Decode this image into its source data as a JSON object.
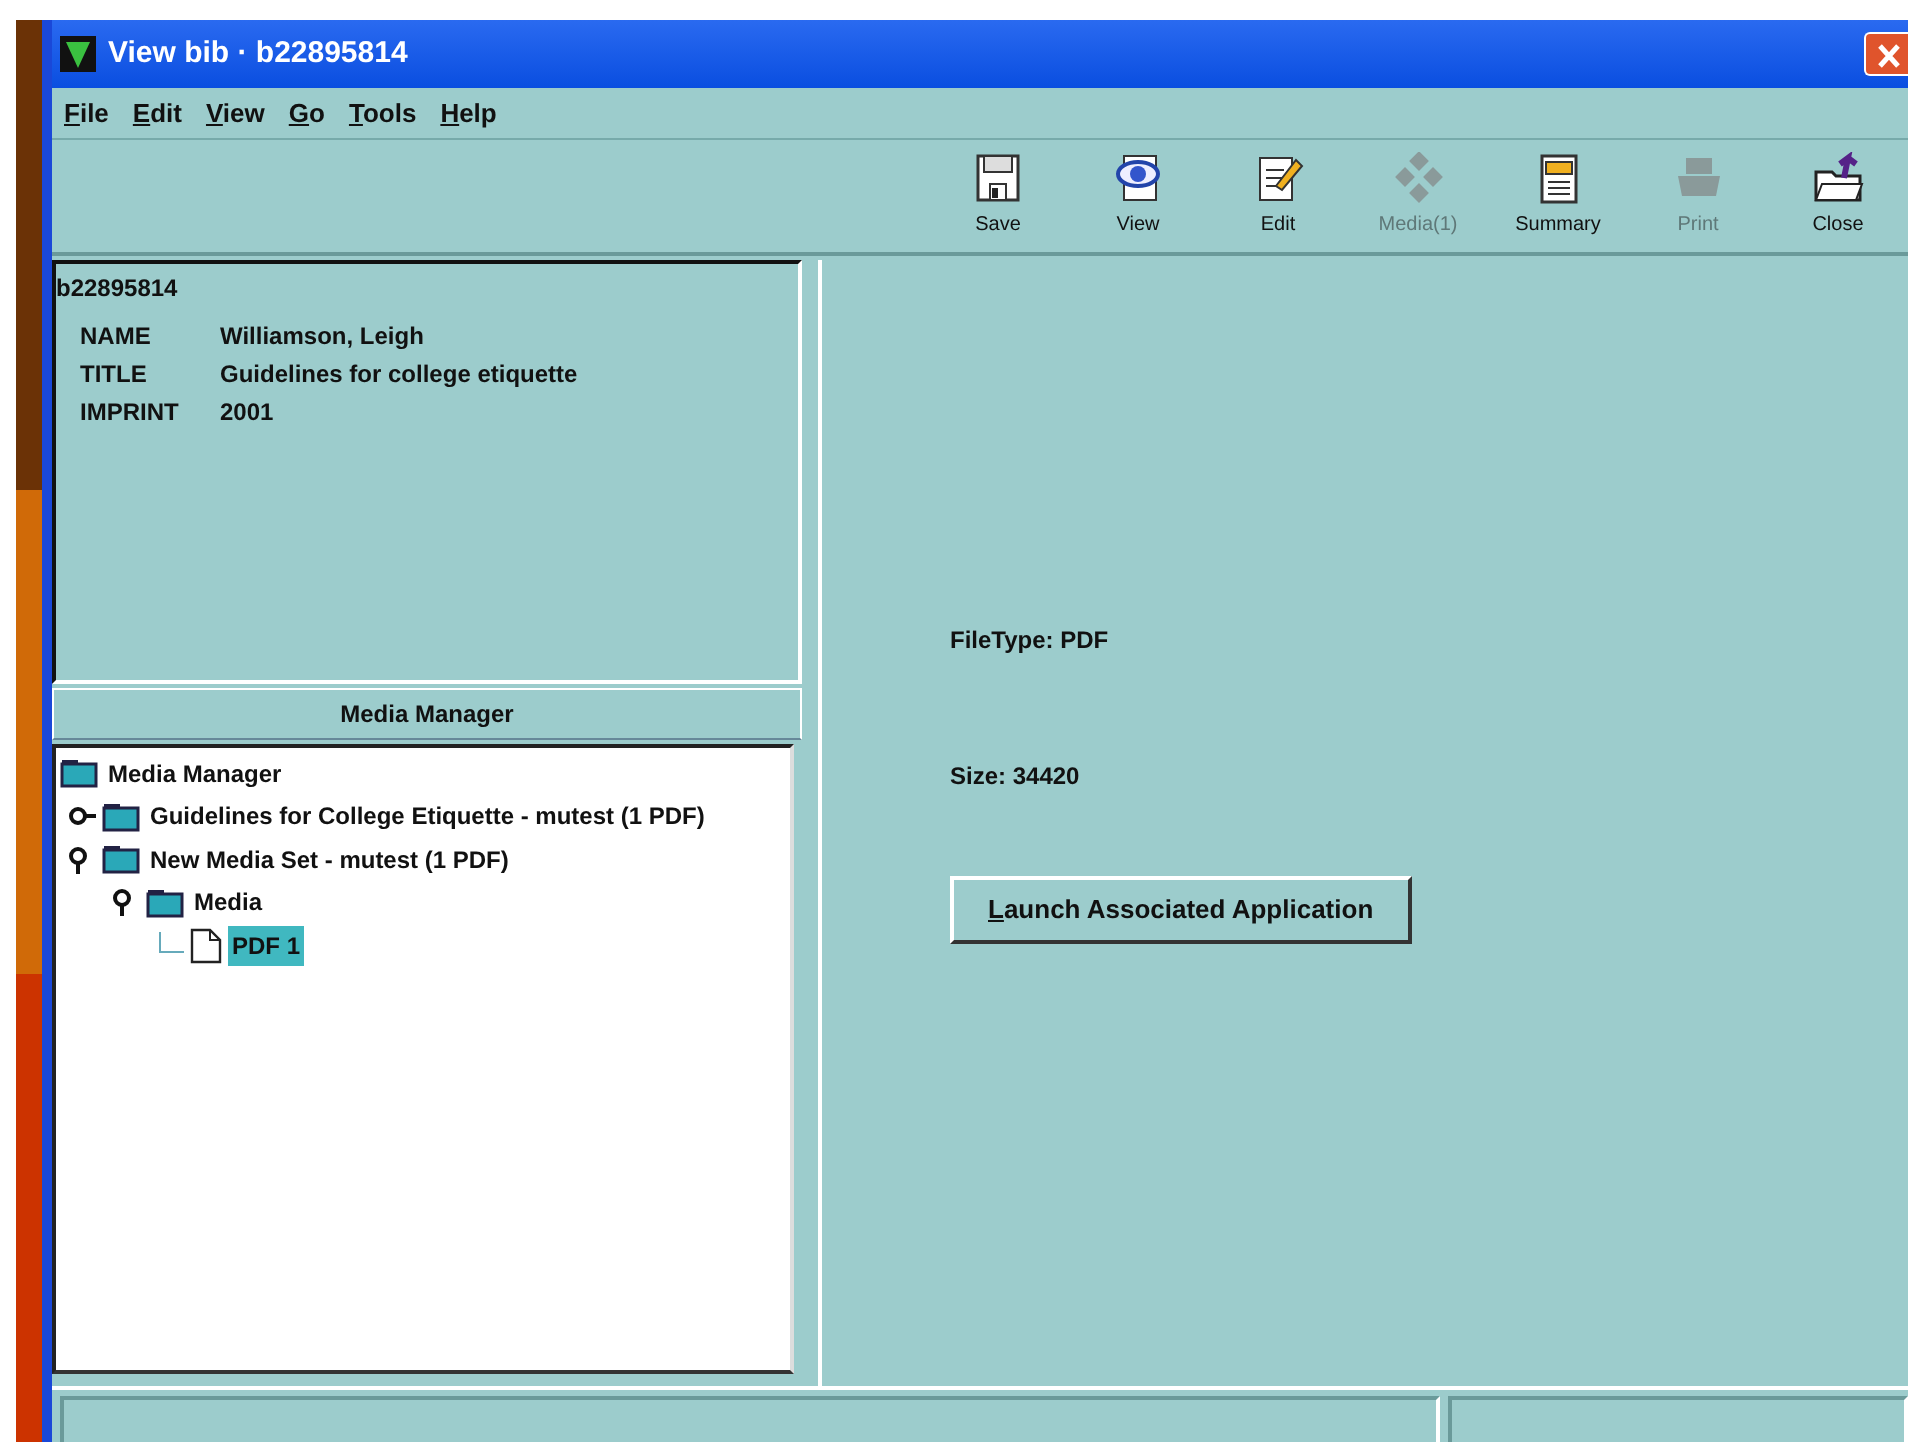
{
  "window": {
    "title": "View bib · b22895814"
  },
  "menu": [
    "File",
    "Edit",
    "View",
    "Go",
    "Tools",
    "Help"
  ],
  "toolbar": [
    {
      "label": "Save",
      "disabled": false
    },
    {
      "label": "View",
      "disabled": false
    },
    {
      "label": "Edit",
      "disabled": false
    },
    {
      "label": "Media(1)",
      "disabled": true
    },
    {
      "label": "Summary",
      "disabled": false
    },
    {
      "label": "Print",
      "disabled": true
    },
    {
      "label": "Close",
      "disabled": false
    }
  ],
  "record": {
    "id": "b22895814",
    "fields": [
      {
        "label": "NAME",
        "value": "Williamson, Leigh"
      },
      {
        "label": "TITLE",
        "value": "Guidelines for college etiquette"
      },
      {
        "label": "IMPRINT",
        "value": "2001"
      }
    ]
  },
  "media_manager": {
    "header": "Media Manager",
    "tree": {
      "label": "Media Manager",
      "kind": "folder",
      "selected": false,
      "children": [
        {
          "label": "Guidelines for College Etiquette - mutest (1 PDF)",
          "kind": "folder",
          "expanded": false,
          "selected": false
        },
        {
          "label": "New Media Set - mutest (1 PDF)",
          "kind": "folder",
          "expanded": true,
          "selected": false,
          "children": [
            {
              "label": "Media",
              "kind": "folder",
              "expanded": true,
              "selected": false,
              "children": [
                {
                  "label": "PDF 1",
                  "kind": "file",
                  "selected": true
                }
              ]
            }
          ]
        }
      ]
    }
  },
  "details": {
    "file_type": "FileType:  PDF",
    "size": "Size:  34420",
    "button": "Launch Associated Application"
  }
}
